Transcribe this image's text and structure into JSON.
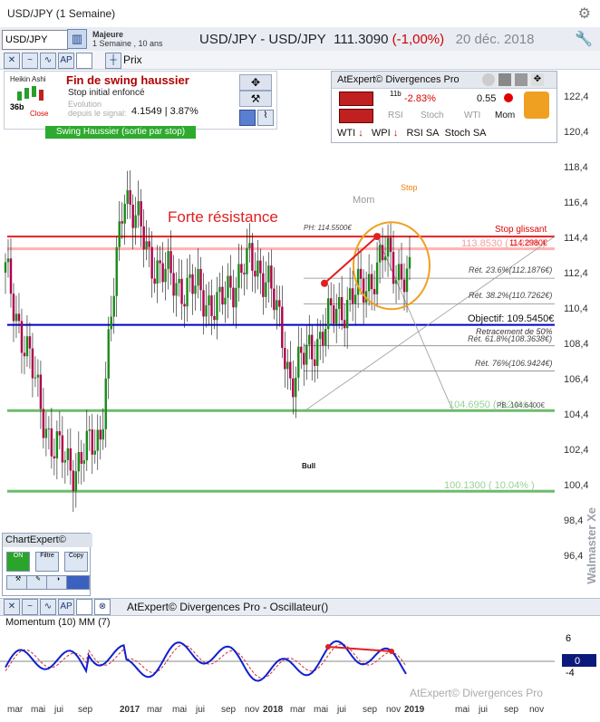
{
  "window": {
    "title": "USD/JPY (1 Semaine)"
  },
  "toolbar": {
    "symbol_value": "USD/JPY",
    "list_name": "Majeure",
    "list_sub": "1 Semaine , 10 ans",
    "main_symbol": "USD/JPY - USD/JPY",
    "price": "111.3090",
    "change": "(-1,00%)",
    "date": "20 déc. 2018",
    "price_label": "Prix"
  },
  "signal_panel": {
    "indicator": "Heikin Ashi",
    "bars": "36b",
    "close": "Close",
    "title": "Fin de swing haussier",
    "stop": "Stop initial enfoncé",
    "evol_label": "Evolution",
    "evol_sub": "depuis le signal:",
    "evol_value": "4.1549 | 3.87%",
    "badge": "Swing Haussier (sortie par stop)"
  },
  "divergences": {
    "title": "AtExpert© Divergences Pro",
    "ind_period": "11b",
    "pct": "-2.83%",
    "value": "0.55",
    "row2": [
      "RSI",
      "Stoch",
      "WTI",
      "Mom"
    ],
    "row3": [
      "WTI",
      "WPI",
      "RSI SA",
      "Stoch SA"
    ]
  },
  "annotations": {
    "forte": "Forte résistance",
    "mom": "Mom",
    "stop": "Stop",
    "stop_glissant": "Stop glissant",
    "ph": "PH: 114.5500€",
    "res_level": "113.8530 ( 2.28% )",
    "res_sub": "114.2980€",
    "fib236": "Rét. 23.6%(112.1876€)",
    "fib382": "Rét. 38.2%(110.7262€)",
    "objectif": "Objectif: 109.5450€",
    "retr50": "Retracement de 50%",
    "fib618": "Rét. 61.8%(108.3638€)",
    "fib76": "Rét. 76%(106.9424€)",
    "sup1": "104.6950 ( 6.24% )",
    "pb": "PB: 104.6400€",
    "sup2": "100.1300 ( 10.04% )",
    "bull": "Bull"
  },
  "chart_data": {
    "type": "line",
    "title": "USD/JPY - USD/JPY",
    "ylim": [
      95.2,
      123.3
    ],
    "yticks": [
      "122,4",
      "120,4",
      "118,4",
      "116,4",
      "114,4",
      "112,4",
      "110,4",
      "108,4",
      "106,4",
      "104,4",
      "102,4",
      "100,4",
      "98,4",
      "96,4"
    ],
    "x": [
      "2016-03",
      "2016-05",
      "2016-07",
      "2016-09",
      "2016-11",
      "2017-01",
      "2017-03",
      "2017-05",
      "2017-07",
      "2017-09",
      "2017-11",
      "2018-01",
      "2018-03",
      "2018-05",
      "2018-07",
      "2018-09",
      "2018-11",
      "2019-01"
    ],
    "series": [
      {
        "values": [
          112.5,
          107.5,
          102.5,
          101.5,
          103.5,
          117.5,
          113.5,
          112.0,
          111.5,
          110.5,
          113.0,
          112.5,
          106.5,
          108.5,
          110.5,
          111.5,
          113.5,
          112.0
        ]
      }
    ],
    "levels": [
      {
        "value": 114.55,
        "label": "PH: 114.5500€",
        "color": "#e02020"
      },
      {
        "value": 113.853,
        "label": "113.8530 ( 2.28% )",
        "color": "#ff8080"
      },
      {
        "value": 112.1876,
        "label": "Rét. 23.6%",
        "color": "#888888"
      },
      {
        "value": 110.7262,
        "label": "Rét. 38.2%",
        "color": "#888888"
      },
      {
        "value": 109.545,
        "label": "Objectif",
        "color": "#0000c8"
      },
      {
        "value": 108.3638,
        "label": "Rét. 61.8%",
        "color": "#888888"
      },
      {
        "value": 106.9424,
        "label": "Rét. 76%",
        "color": "#888888"
      },
      {
        "value": 104.695,
        "label": "104.6950 ( 6.24% )",
        "color": "#30a030"
      },
      {
        "value": 100.13,
        "label": "100.1300 ( 10.04% )",
        "color": "#30a030"
      }
    ]
  },
  "oscillator": {
    "title": "AtExpert© Divergences Pro - Oscillateur()",
    "label": "Momentum (10) MM (7)",
    "yticks": [
      "6",
      "0",
      "-4"
    ],
    "copyright": "AtExpert© Divergences Pro"
  },
  "xaxis": [
    "mar",
    "mai",
    "jui",
    "sep",
    "2017",
    "mar",
    "mai",
    "jui",
    "sep",
    "nov",
    "2018",
    "mar",
    "mai",
    "jui",
    "sep",
    "nov",
    "2019",
    "mai",
    "jui",
    "sep",
    "nov"
  ],
  "chartexpert": {
    "title": "ChartExpert©",
    "on": "ON",
    "filtre": "Filtre",
    "copy": "Copy"
  },
  "watermark": "Walmaster Xe"
}
